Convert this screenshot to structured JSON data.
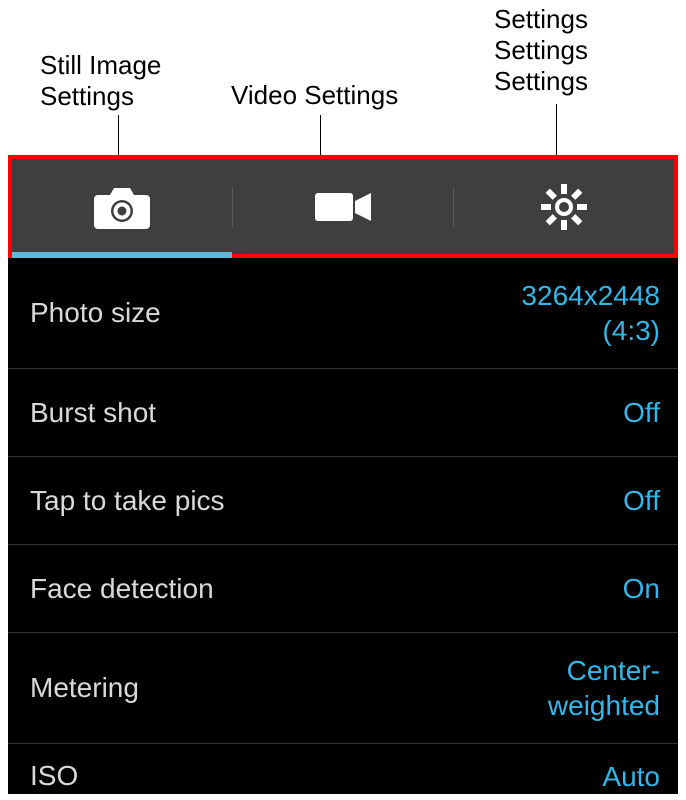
{
  "annotations": {
    "still": "Still Image\nSettings",
    "video": "Video Settings",
    "gear": "Settings\nSettings\nSettings"
  },
  "tabs": {
    "still": {
      "active": true
    },
    "video": {
      "active": false
    },
    "gear": {
      "active": false
    }
  },
  "settings": [
    {
      "label": "Photo size",
      "value": "3264x2448\n(4:3)"
    },
    {
      "label": "Burst shot",
      "value": "Off"
    },
    {
      "label": "Tap to take pics",
      "value": "Off"
    },
    {
      "label": "Face detection",
      "value": "On"
    },
    {
      "label": "Metering",
      "value": "Center-\nweighted"
    },
    {
      "label": "ISO",
      "value": "Auto"
    }
  ]
}
